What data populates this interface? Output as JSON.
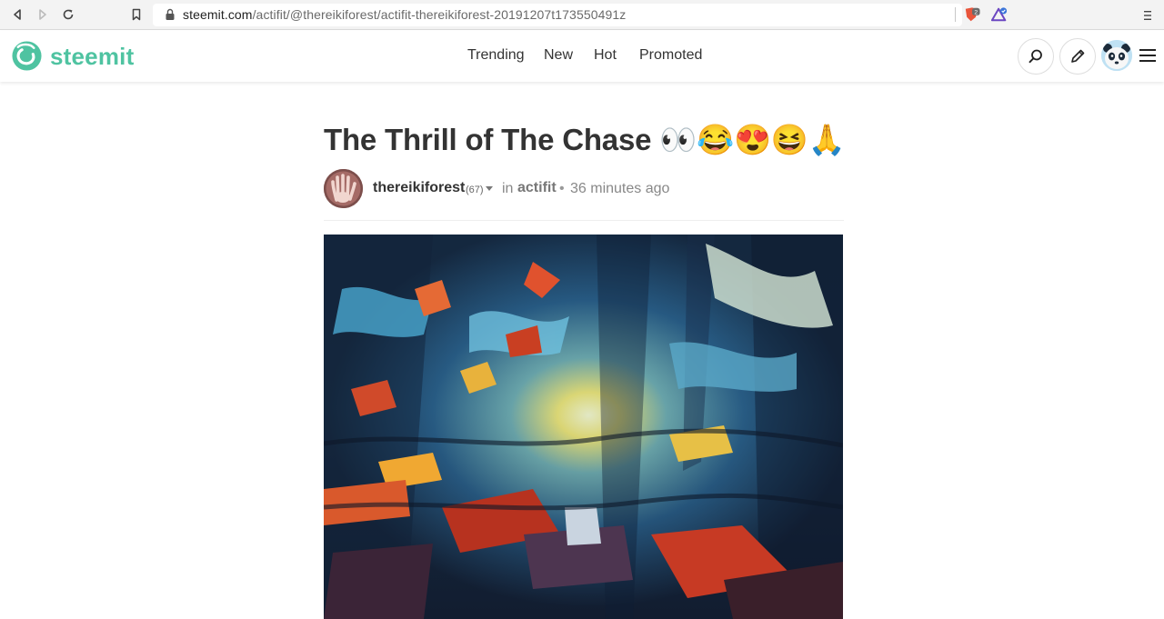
{
  "browser": {
    "url_host": "steemit.com",
    "url_path": "/actifit/@thereikiforest/actifit-thereikiforest-20191207t173550491z",
    "extension_badge": "2"
  },
  "header": {
    "brand": "steemit",
    "nav": [
      "Trending",
      "New",
      "Hot",
      "Promoted"
    ]
  },
  "post": {
    "title": "The Thrill of The Chase 👀😂😍😆🙏",
    "author": "thereikiforest",
    "reputation": "(67)",
    "in_label": "in",
    "community": "actifit",
    "separator": "•",
    "time_ago": "36 minutes ago"
  },
  "colors": {
    "brand": "#4fc3a1",
    "text": "#333333"
  }
}
